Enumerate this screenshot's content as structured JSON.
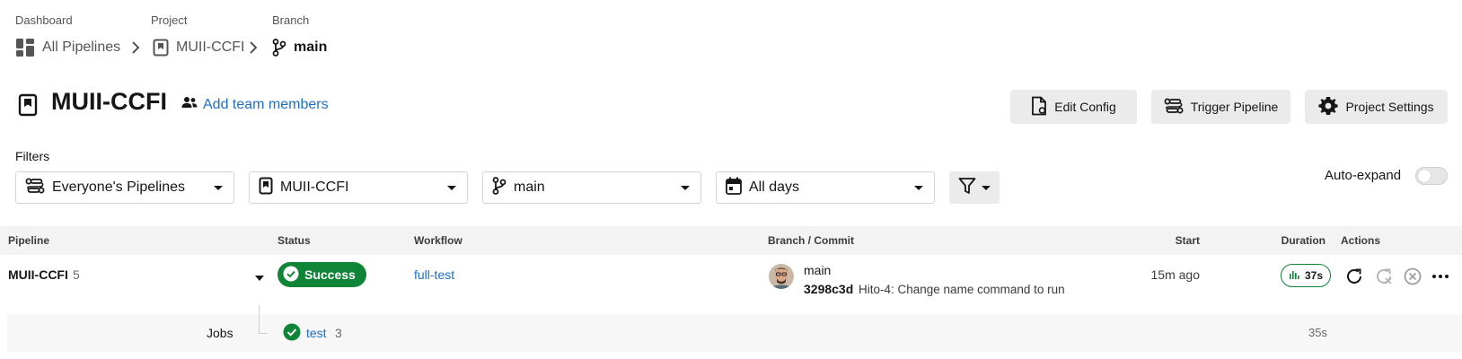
{
  "breadcrumb": {
    "dashboard_label": "Dashboard",
    "dashboard_value": "All Pipelines",
    "project_label": "Project",
    "project_value": "MUII-CCFI",
    "branch_label": "Branch",
    "branch_value": "main"
  },
  "header": {
    "title": "MUII-CCFI",
    "add_members": "Add team members",
    "edit_config": "Edit Config",
    "trigger_pipeline": "Trigger Pipeline",
    "project_settings": "Project Settings"
  },
  "filters": {
    "label": "Filters",
    "pipelines": "Everyone's Pipelines",
    "project": "MUII-CCFI",
    "branch": "main",
    "days": "All days",
    "auto_expand": "Auto-expand",
    "auto_expand_on": false
  },
  "table": {
    "headers": {
      "pipeline": "Pipeline",
      "status": "Status",
      "workflow": "Workflow",
      "branch_commit": "Branch / Commit",
      "start": "Start",
      "duration": "Duration",
      "actions": "Actions"
    },
    "row": {
      "pipeline": "MUII-CCFI",
      "number": "5",
      "status": "Success",
      "workflow": "full-test",
      "branch": "main",
      "commit_hash": "3298c3d",
      "commit_message": "Hito-4: Change name command to run",
      "start": "15m ago",
      "duration": "37s"
    },
    "jobs": {
      "label": "Jobs",
      "name": "test",
      "number": "3",
      "duration": "35s"
    }
  },
  "colors": {
    "success": "#0f8537",
    "link": "#1f6fc5",
    "button_bg": "#ebebeb"
  }
}
